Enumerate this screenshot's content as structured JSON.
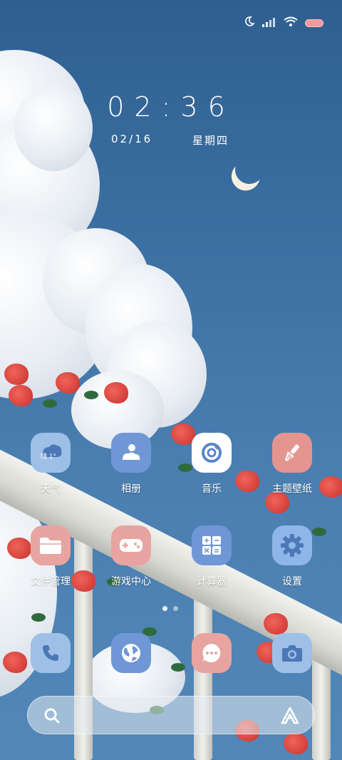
{
  "status_bar": {
    "icons": [
      "moon-icon",
      "signal-icon",
      "wifi-icon",
      "battery-icon"
    ],
    "battery_color": "#f29a9a"
  },
  "clock": {
    "time": "02:36",
    "date": "02/16",
    "weekday": "星期四"
  },
  "apps": [
    {
      "label": "天气",
      "icon": "weather-icon",
      "badge": "晴 1°",
      "bg": "#9ec0e6"
    },
    {
      "label": "相册",
      "icon": "gallery-icon",
      "bg": "#6f97d6"
    },
    {
      "label": "音乐",
      "icon": "music-icon",
      "bg": "#ffffff"
    },
    {
      "label": "主题壁纸",
      "icon": "theme-brush-icon",
      "bg": "#e4958f"
    },
    {
      "label": "文件管理",
      "icon": "folder-icon",
      "bg": "#e8a4a0"
    },
    {
      "label": "游戏中心",
      "icon": "gamepad-icon",
      "bg": "#e8a4a0"
    },
    {
      "label": "计算器",
      "icon": "calculator-icon",
      "bg": "#6f97d6"
    },
    {
      "label": "设置",
      "icon": "settings-gear-icon",
      "bg": "#8fb6e8"
    }
  ],
  "dock": [
    {
      "icon": "phone-icon",
      "bg": "#9ec0e6"
    },
    {
      "icon": "browser-globe-icon",
      "bg": "#6f97d6"
    },
    {
      "icon": "messages-icon",
      "bg": "#e8a4a0"
    },
    {
      "icon": "camera-icon",
      "bg": "#9ec0e6"
    }
  ],
  "pager": {
    "pages": 2,
    "current": 1
  },
  "search": {
    "icons": [
      "search-icon",
      "assistant-icon"
    ]
  }
}
